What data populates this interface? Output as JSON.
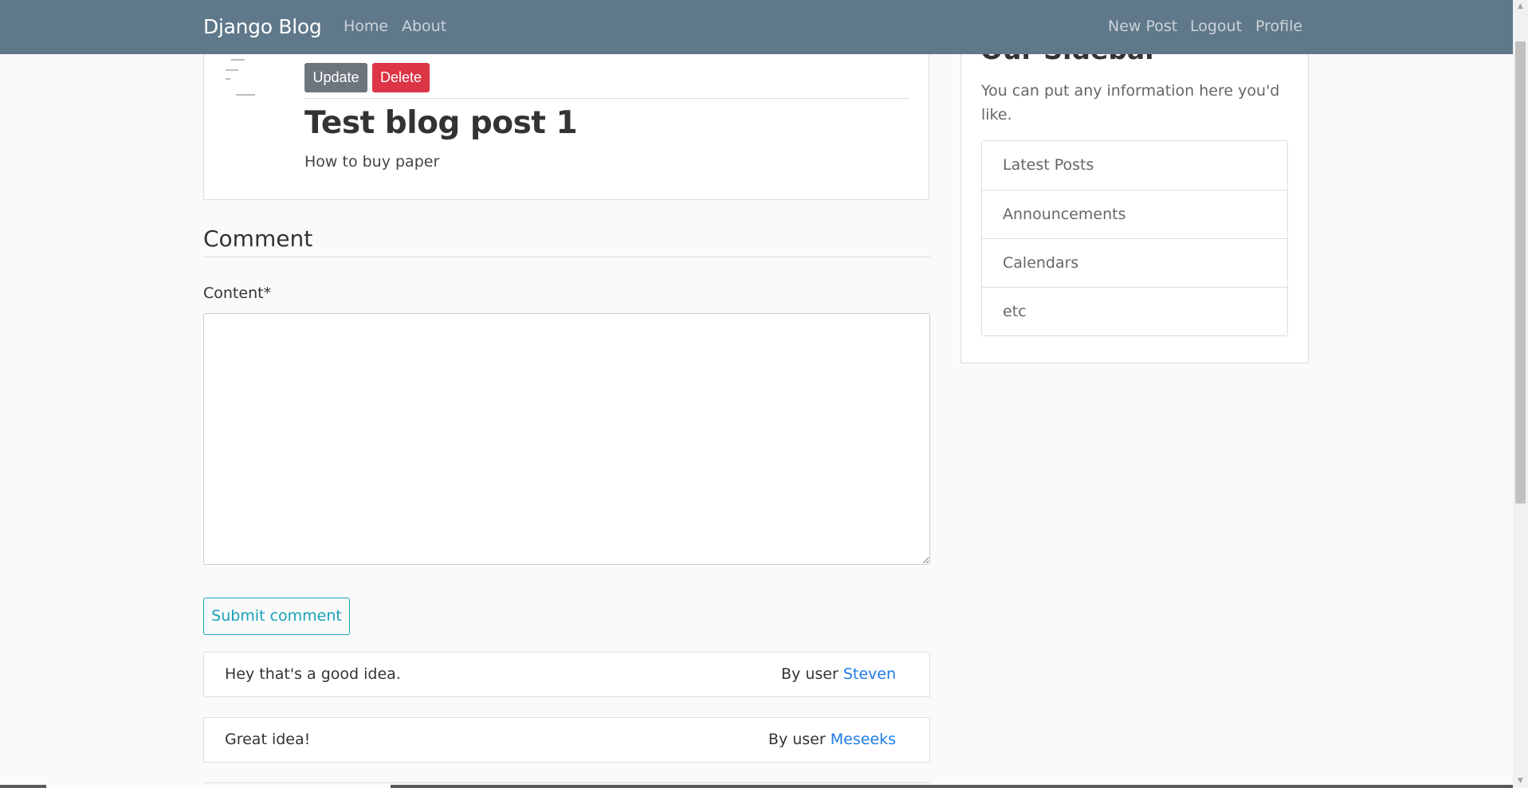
{
  "navbar": {
    "brand": "Django Blog",
    "left_links": [
      "Home",
      "About"
    ],
    "right_links": [
      "New Post",
      "Logout",
      "Profile"
    ],
    "color": "#5f788a"
  },
  "post": {
    "update_label": "Update",
    "delete_label": "Delete",
    "title": "Test blog post 1",
    "content": "How to buy paper"
  },
  "comment_form": {
    "heading": "Comment",
    "content_label": "Content*",
    "content_value": "",
    "submit_label": "Submit comment"
  },
  "comments": [
    {
      "text": "Hey that's a good idea.",
      "by": "By user",
      "user": "Steven"
    },
    {
      "text": "Great idea!",
      "by": "By user",
      "user": "Meseeks"
    }
  ],
  "sidebar": {
    "heading": "Our Sidebar",
    "description": "You can put any information here you'd like.",
    "items": [
      "Latest Posts",
      "Announcements",
      "Calendars",
      "etc"
    ]
  },
  "colors": {
    "update_button": "#6c757d",
    "delete_button": "#dc3545",
    "submit_button": "#17a2b8",
    "link": "#1e7be6"
  }
}
